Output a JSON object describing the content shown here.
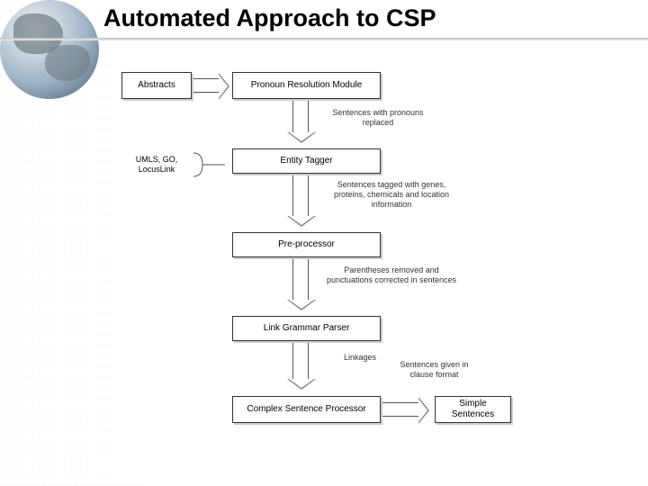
{
  "title": "Automated Approach to CSP",
  "flow": {
    "abstracts": "Abstracts",
    "pronoun_module": "Pronoun Resolution Module",
    "label_after_pronoun": "Sentences with pronouns replaced",
    "sources": "UMLS, GO, LocusLink",
    "entity_tagger": "Entity Tagger",
    "label_after_entity": "Sentences tagged with genes, proteins, chemicals and location information",
    "preprocessor": "Pre-processor",
    "label_after_preproc": "Parentheses removed and punctuations corrected in sentences",
    "parser": "Link Grammar Parser",
    "label_after_parser": "Linkages",
    "csp": "Complex Sentence Processor",
    "label_to_simple": "Sentences given in clause format",
    "simple": "Simple Sentences"
  }
}
